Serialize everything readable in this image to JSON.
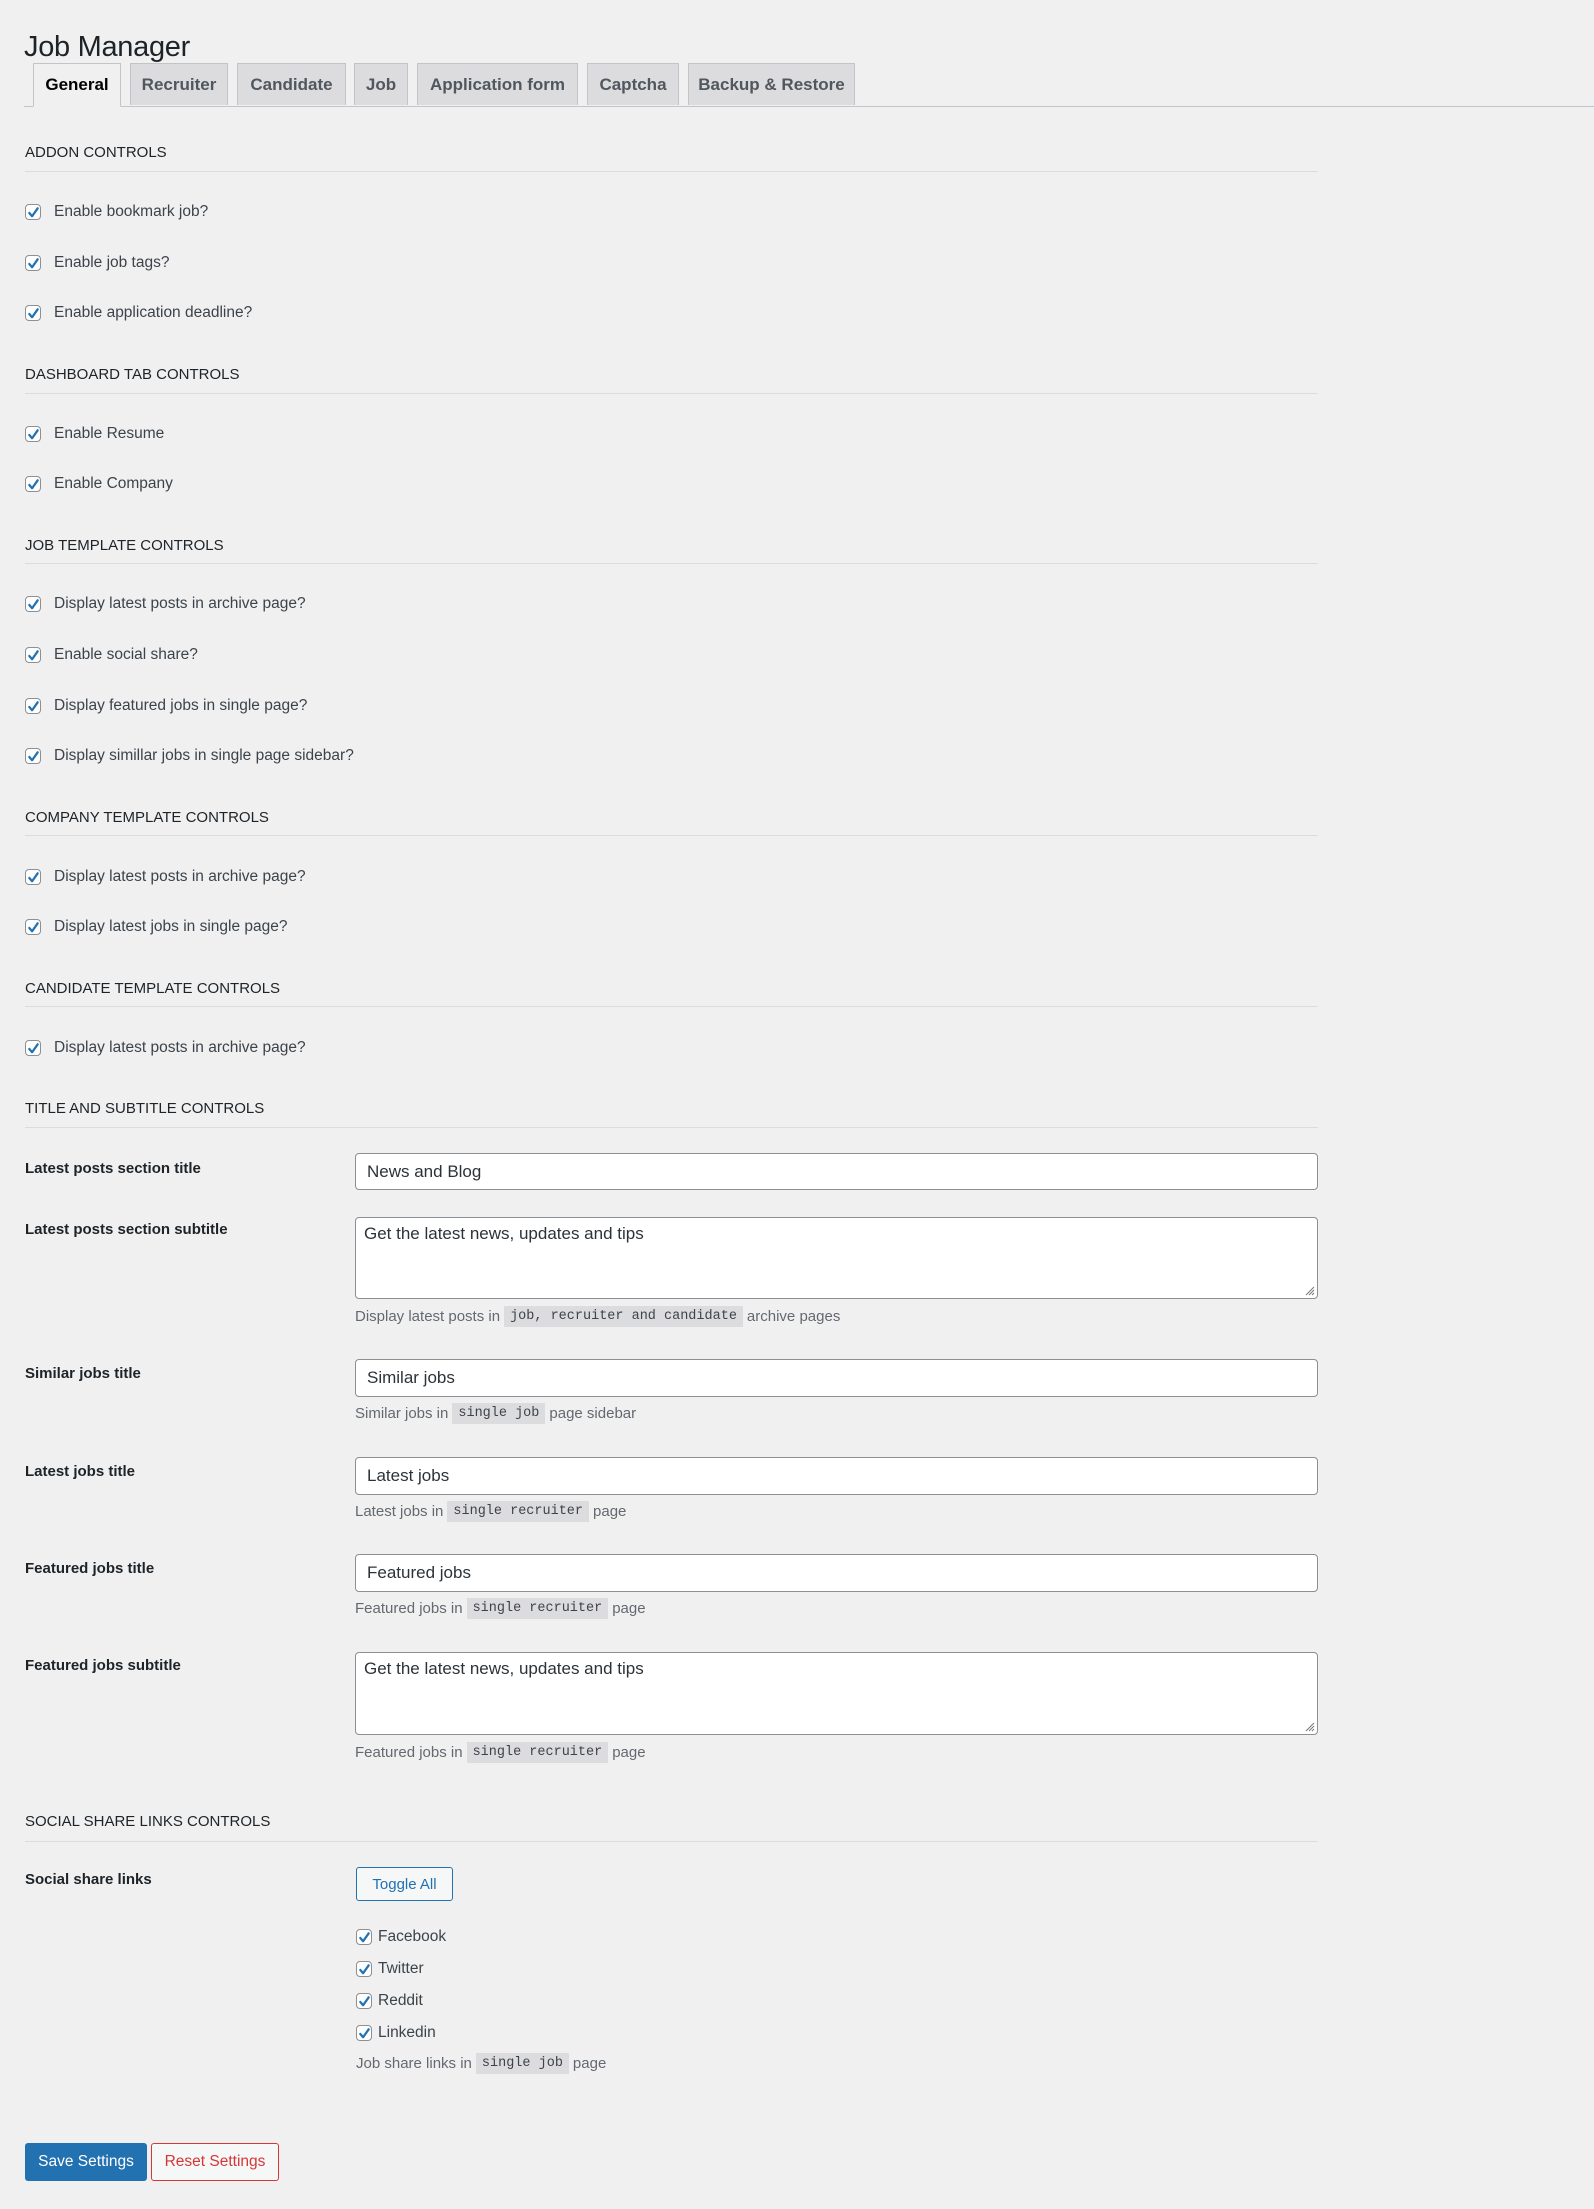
{
  "page": {
    "title": "Job Manager"
  },
  "tabs": [
    {
      "label": "General",
      "active": true
    },
    {
      "label": "Recruiter",
      "active": false
    },
    {
      "label": "Candidate",
      "active": false
    },
    {
      "label": "Job",
      "active": false
    },
    {
      "label": "Application form",
      "active": false
    },
    {
      "label": "Captcha",
      "active": false
    },
    {
      "label": "Backup & Restore",
      "active": false
    }
  ],
  "sections": {
    "addon": {
      "title": "Addon Controls",
      "items": [
        {
          "label": "Enable bookmark job?",
          "checked": true
        },
        {
          "label": "Enable job tags?",
          "checked": true
        },
        {
          "label": "Enable application deadline?",
          "checked": true
        }
      ]
    },
    "dashboard": {
      "title": "Dashboard Tab Controls",
      "items": [
        {
          "label": "Enable Resume",
          "checked": true
        },
        {
          "label": "Enable Company",
          "checked": true
        }
      ]
    },
    "job_template": {
      "title": "Job Template Controls",
      "items": [
        {
          "label": "Display latest posts in archive page?",
          "checked": true
        },
        {
          "label": "Enable social share?",
          "checked": true
        },
        {
          "label": "Display featured jobs in single page?",
          "checked": true
        },
        {
          "label": "Display simillar jobs in single page sidebar?",
          "checked": true
        }
      ]
    },
    "company_template": {
      "title": "Company Template Controls",
      "items": [
        {
          "label": "Display latest posts in archive page?",
          "checked": true
        },
        {
          "label": "Display latest jobs in single page?",
          "checked": true
        }
      ]
    },
    "candidate_template": {
      "title": "Candidate Template Controls",
      "items": [
        {
          "label": "Display latest posts in archive page?",
          "checked": true
        }
      ]
    },
    "titles": {
      "title": "Title and Subtitle Controls",
      "fields": [
        {
          "label": "Latest posts section title",
          "value": "News and Blog"
        },
        {
          "label": "Latest posts section subtitle",
          "value": "Get the latest news, updates and tips",
          "desc_pre": "Display latest posts in",
          "desc_code": "job, recruiter and candidate",
          "desc_post": "archive pages"
        },
        {
          "label": "Similar jobs title",
          "value": "Similar jobs",
          "desc_pre": "Similar jobs in",
          "desc_code": "single job",
          "desc_post": "page sidebar"
        },
        {
          "label": "Latest jobs title",
          "value": "Latest jobs",
          "desc_pre": "Latest jobs in",
          "desc_code": "single recruiter",
          "desc_post": "page"
        },
        {
          "label": "Featured jobs title",
          "value": "Featured jobs",
          "desc_pre": "Featured jobs in",
          "desc_code": "single recruiter",
          "desc_post": "page"
        },
        {
          "label": "Featured jobs subtitle",
          "value": "Get the latest news, updates and tips",
          "desc_pre": "Featured jobs in",
          "desc_code": "single recruiter",
          "desc_post": "page"
        }
      ]
    },
    "social": {
      "title": "Social Share Links Controls",
      "label": "Social share links",
      "toggle_label": "Toggle All",
      "items": [
        {
          "label": "Facebook",
          "checked": true
        },
        {
          "label": "Twitter",
          "checked": true
        },
        {
          "label": "Reddit",
          "checked": true
        },
        {
          "label": "Linkedin",
          "checked": true
        }
      ],
      "desc_pre": "Job share links in",
      "desc_code": "single job",
      "desc_post": "page"
    }
  },
  "actions": {
    "save_label": "Save Settings",
    "reset_label": "Reset Settings"
  },
  "colors": {
    "accent": "#2271b1",
    "danger": "#d63638",
    "background": "#f0f0f1"
  }
}
